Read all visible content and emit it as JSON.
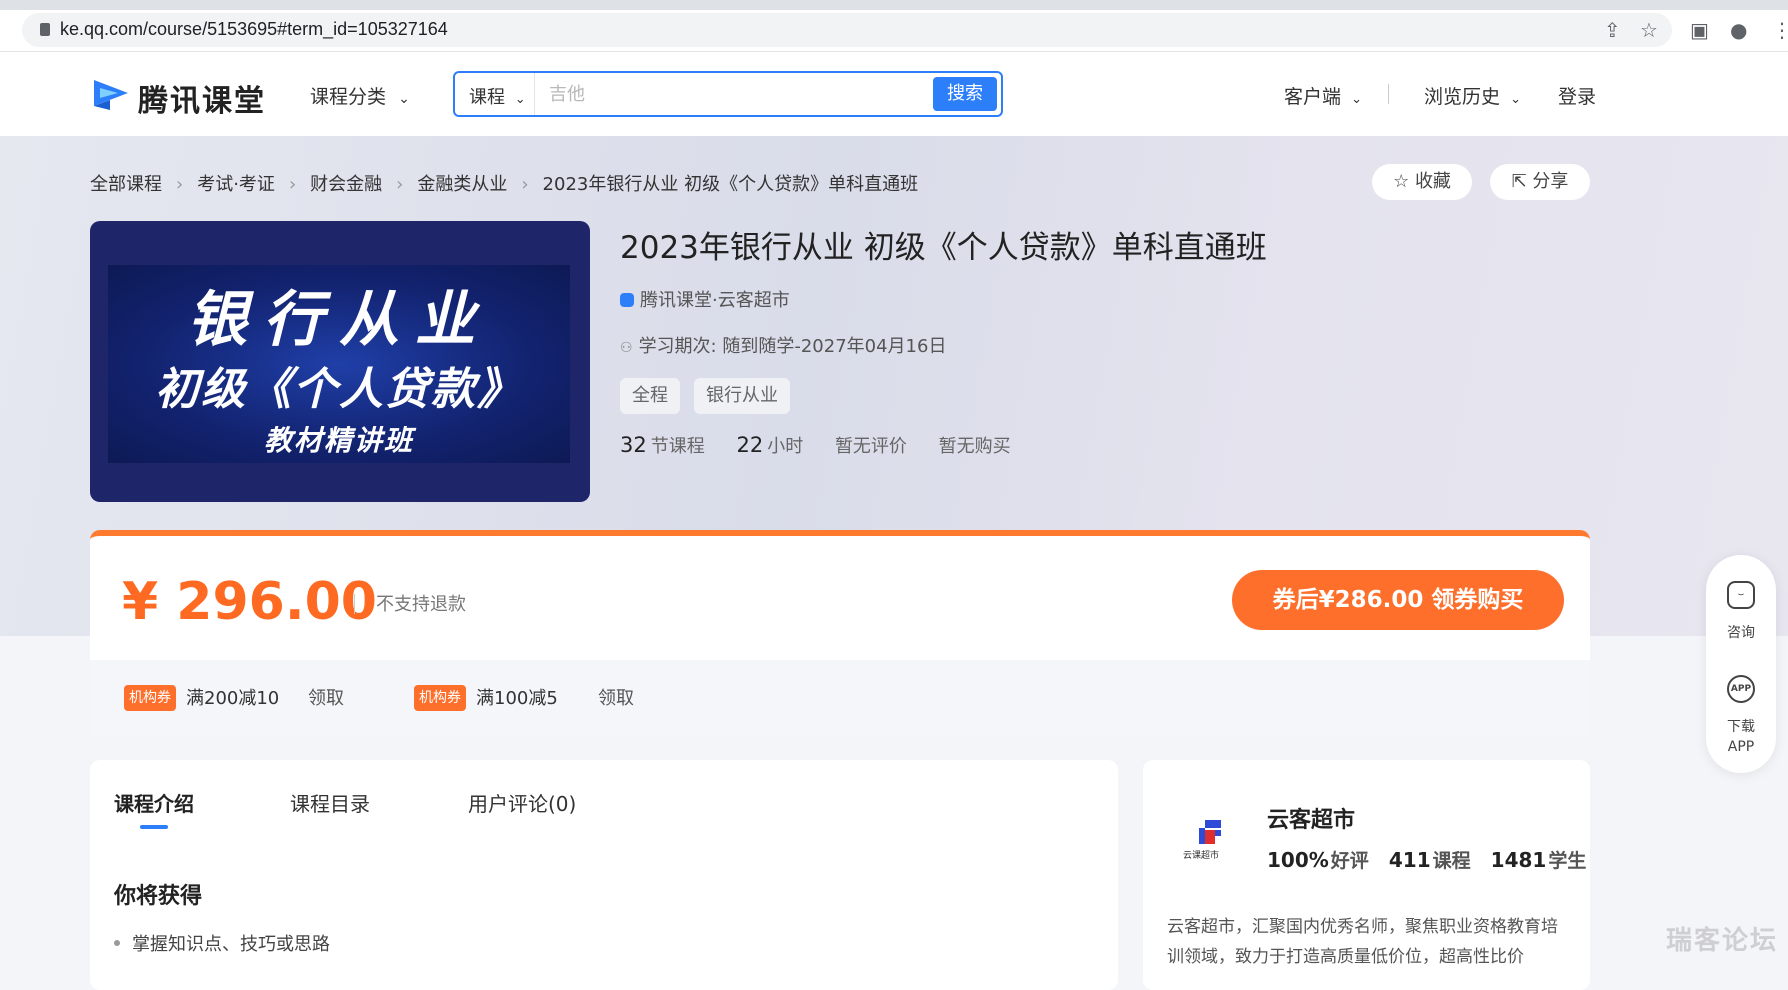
{
  "browser": {
    "url": "ke.qq.com/course/5153695#term_id=105327164"
  },
  "header": {
    "logo_text": "腾讯课堂",
    "nav_category": "课程分类",
    "search": {
      "type_label": "课程",
      "placeholder": "吉他",
      "button": "搜索"
    },
    "client": "客户端",
    "history": "浏览历史",
    "login": "登录"
  },
  "breadcrumbs": [
    "全部课程",
    "考试·考证",
    "财会金融",
    "金融类从业",
    "2023年银行从业 初级《个人贷款》单科直通班"
  ],
  "actions": {
    "favorite": "收藏",
    "share": "分享"
  },
  "cover": {
    "line1": "银行从业",
    "line2": "初级《个人贷款》",
    "line3": "教材精讲班"
  },
  "course": {
    "title": "2023年银行从业 初级《个人贷款》单科直通班",
    "provider": "腾讯课堂·云客超市",
    "period": "学习期次: 随到随学-2027年04月16日",
    "tags": [
      "全程",
      "银行从业"
    ],
    "lessons_num": "32",
    "lessons_label": "节课程",
    "hours_num": "22",
    "hours_label": "小时",
    "rating": "暂无评价",
    "purchases": "暂无购买"
  },
  "pricing": {
    "price": "¥ 296.00",
    "refund_note": "不支持退款",
    "buy_button": "券后¥286.00  领券购买",
    "coupons": [
      {
        "tag": "机构券",
        "text": "满200减10",
        "action": "领取"
      },
      {
        "tag": "机构券",
        "text": "满100减5",
        "action": "领取"
      }
    ]
  },
  "tabs": [
    "课程介绍",
    "课程目录",
    "用户评论(0)"
  ],
  "intro": {
    "gain_title": "你将获得",
    "gain_items": [
      "掌握知识点、技巧或思路"
    ]
  },
  "org": {
    "logo_caption": "云课超市",
    "name": "云客超市",
    "rating_num": "100%",
    "rating_label": "好评",
    "courses_num": "411",
    "courses_label": "课程",
    "students_num": "1481",
    "students_label": "学生",
    "description": "云客超市，汇聚国内优秀名师，聚焦职业资格教育培训领域，致力于打造高质量低价位，超高性比价"
  },
  "side": {
    "consult": "咨询",
    "app_icon": "APP",
    "download_line1": "下载",
    "download_line2": "APP"
  },
  "watermark": "瑞客论坛"
}
